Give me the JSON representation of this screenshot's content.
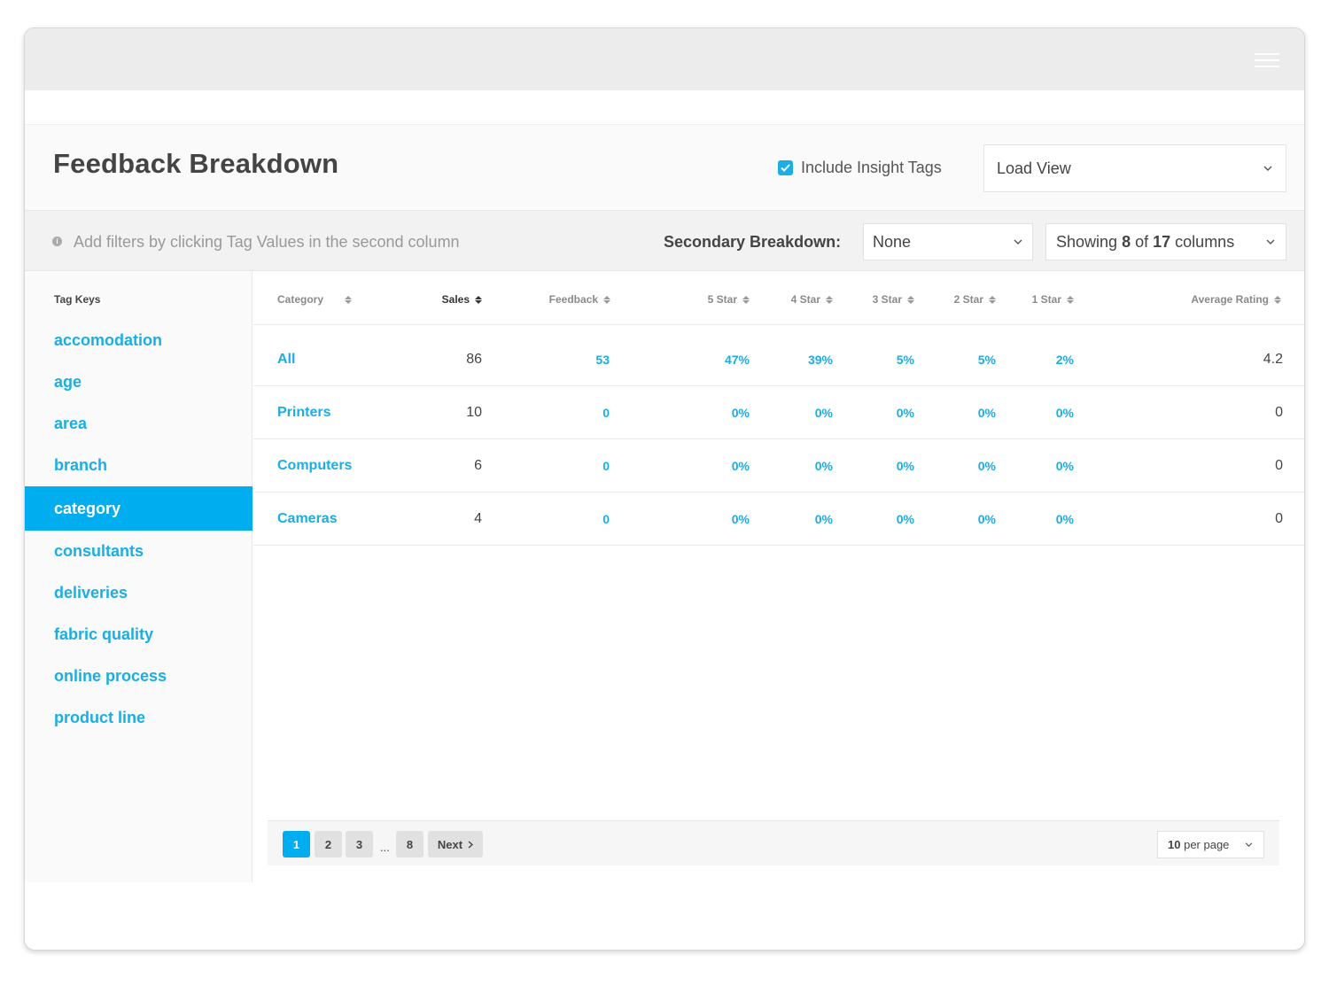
{
  "header": {
    "title": "Feedback Breakdown",
    "include_insight_tags_label": "Include Insight Tags",
    "include_insight_tags_checked": true,
    "load_view": "Load View"
  },
  "filter_bar": {
    "hint": "Add filters by clicking Tag Values in the second column",
    "secondary_label": "Secondary Breakdown:",
    "secondary_value": "None",
    "columns_prefix": "Showing",
    "columns_shown": "8",
    "columns_of": "of",
    "columns_total": "17",
    "columns_suffix": "columns"
  },
  "sidebar": {
    "heading": "Tag Keys",
    "items": [
      {
        "label": "accomodation"
      },
      {
        "label": "age"
      },
      {
        "label": "area"
      },
      {
        "label": "branch"
      },
      {
        "label": "category",
        "active": true
      },
      {
        "label": "consultants"
      },
      {
        "label": "deliveries"
      },
      {
        "label": "fabric quality"
      },
      {
        "label": "online process"
      },
      {
        "label": "product line"
      }
    ]
  },
  "table": {
    "columns": [
      "Category",
      "Sales",
      "Feedback",
      "5 Star",
      "4 Star",
      "3 Star",
      "2 Star",
      "1 Star",
      "Average Rating"
    ],
    "rows": [
      [
        "All",
        "86",
        "53",
        "47%",
        "39%",
        "5%",
        "5%",
        "2%",
        "4.2"
      ],
      [
        "Printers",
        "10",
        "0",
        "0%",
        "0%",
        "0%",
        "0%",
        "0%",
        "0"
      ],
      [
        "Computers",
        "6",
        "0",
        "0%",
        "0%",
        "0%",
        "0%",
        "0%",
        "0"
      ],
      [
        "Cameras",
        "4",
        "0",
        "0%",
        "0%",
        "0%",
        "0%",
        "0%",
        "0"
      ]
    ]
  },
  "pagination": {
    "pages": [
      "1",
      "2",
      "3"
    ],
    "ellipsis": "...",
    "last_page": "8",
    "next_label": "Next",
    "per_page_value": "10",
    "per_page_suffix": "per page"
  },
  "colors": {
    "accent": "#00adee",
    "link": "#1aaee5",
    "topbar": "#ececec"
  }
}
